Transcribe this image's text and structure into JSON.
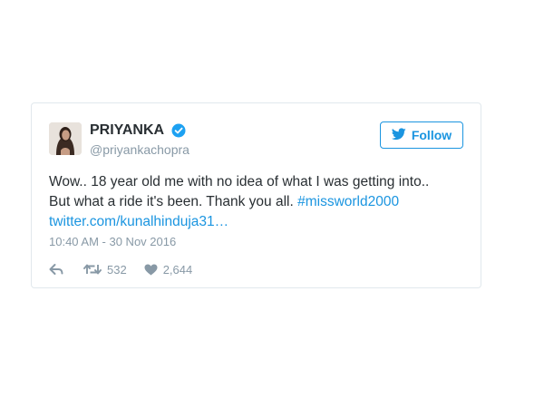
{
  "tweet": {
    "display_name": "PRIYANKA",
    "handle": "@priyankachopra",
    "follow_label": "Follow",
    "text_line1": "Wow.. 18 year old me with no idea of what I was getting into..",
    "text_line2_plain": "But what a ride it's been. Thank you all. ",
    "hashtag": "#missworld2000",
    "link": "twitter.com/kunalhinduja31…",
    "timestamp": "10:40 AM - 30 Nov 2016",
    "retweet_count": "532",
    "like_count": "2,644"
  },
  "icons": {
    "verified": "verified-badge-icon",
    "follow": "twitter-bird-icon",
    "reply": "reply-icon",
    "retweet": "retweet-icon",
    "like": "heart-icon"
  },
  "colors": {
    "accent": "#1b95e0",
    "text": "#292f33",
    "muted": "#8899a6",
    "border": "#e1e8ed"
  }
}
